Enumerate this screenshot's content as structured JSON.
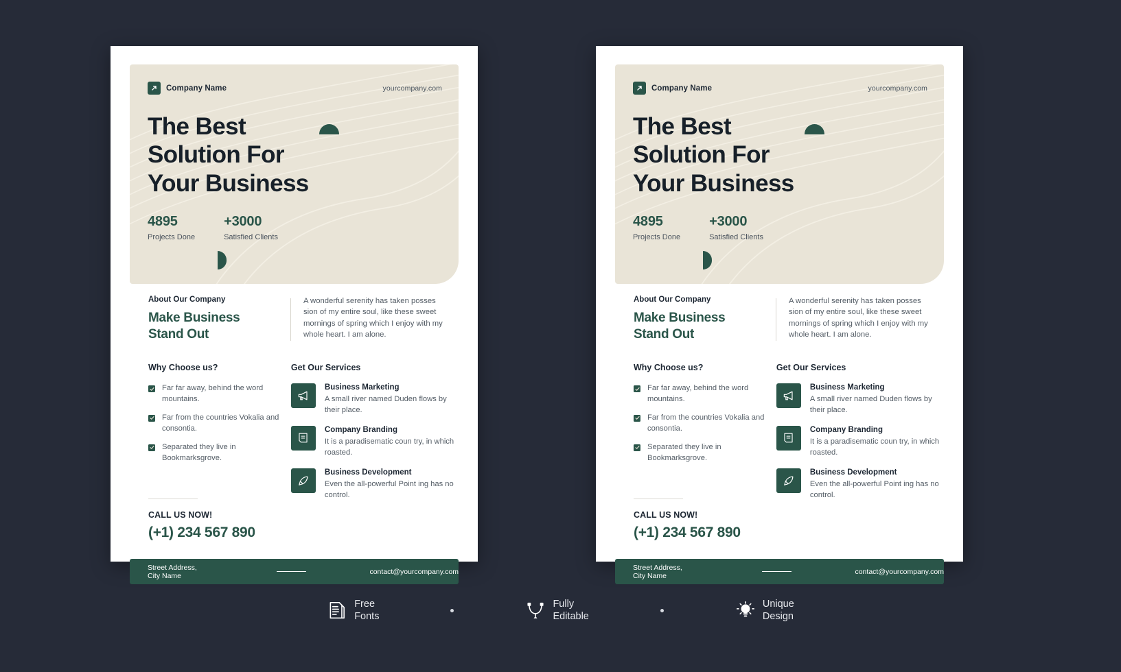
{
  "meta": {
    "background_color": "#262b38",
    "accent_green": "#2a5549",
    "hero_bg": "#e9e4d7",
    "dark_text": "#1d2733",
    "body_text": "#545d66"
  },
  "poster": {
    "header": {
      "logo_icon": "diagonal-arrow-icon",
      "brand_name": "Company Name",
      "website": "yourcompany.com"
    },
    "hero": {
      "title_line1": "The Best",
      "title_line2": "Solution For",
      "title_line3": "Your Business",
      "stats": [
        {
          "number": "4895",
          "label": "Projects Done"
        },
        {
          "number": "+3000",
          "label": "Satisfied Clients"
        }
      ]
    },
    "about": {
      "kicker": "About Our Company",
      "heading_line1": "Make Business",
      "heading_line2": "Stand Out",
      "body": "A wonderful serenity has taken posses sion of my entire soul, like these sweet mornings of spring which I enjoy with my whole heart. I am alone."
    },
    "why": {
      "heading": "Why Choose us?",
      "items": [
        "Far far away, behind the word mountains.",
        "Far from the countries Vokalia and consontia.",
        "Separated they live in Bookmarksgrove."
      ]
    },
    "services": {
      "heading": "Get Our Services",
      "items": [
        {
          "icon": "megaphone-icon",
          "title": "Business Marketing",
          "desc": "A small river named Duden flows by their place."
        },
        {
          "icon": "document-icon",
          "title": "Company Branding",
          "desc": "It is a paradisematic coun try, in which roasted."
        },
        {
          "icon": "rocket-icon",
          "title": "Business Development",
          "desc": "Even the all-powerful Point ing has no control."
        }
      ]
    },
    "call": {
      "kicker": "CALL US NOW!",
      "phone": "(+1) 234 567 890"
    },
    "footer": {
      "address": "Street Address, City Name",
      "email": "contact@yourcompany.com"
    }
  },
  "badges": [
    {
      "icon": "document-stack-icon",
      "line1": "Free",
      "line2": "Fonts"
    },
    {
      "icon": "bezier-pen-icon",
      "line1": "Fully",
      "line2": "Editable"
    },
    {
      "icon": "lightbulb-icon",
      "line1": "Unique",
      "line2": "Design"
    }
  ]
}
